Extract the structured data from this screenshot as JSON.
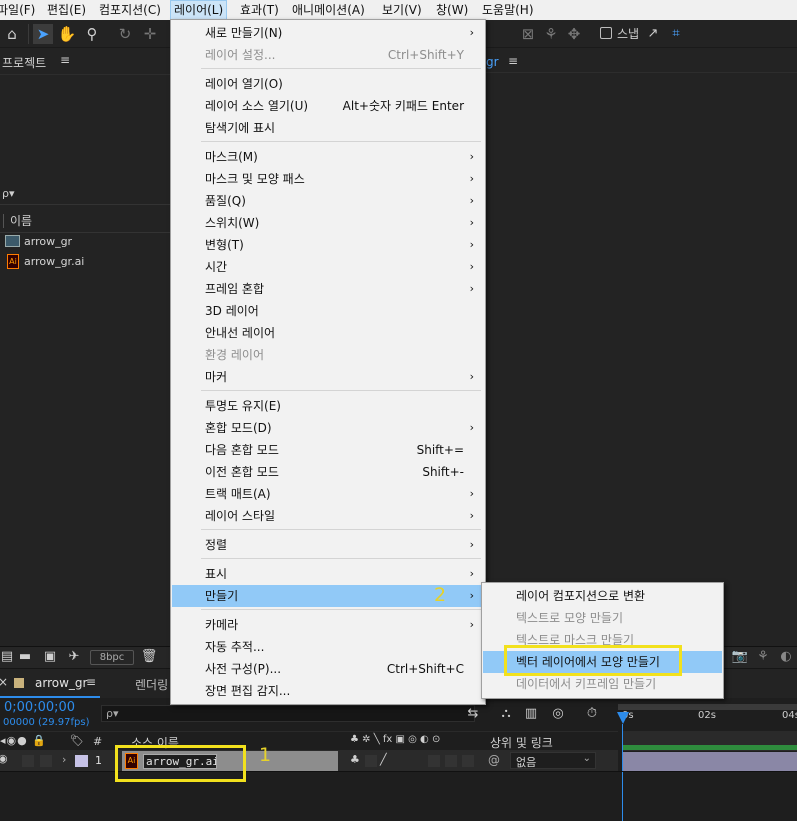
{
  "menubar": {
    "items": [
      {
        "label": "파일(F)"
      },
      {
        "label": "편집(E)"
      },
      {
        "label": "컴포지션(C)"
      },
      {
        "label": "레이어(L)"
      },
      {
        "label": "효과(T)"
      },
      {
        "label": "애니메이션(A)"
      },
      {
        "label": "보기(V)"
      },
      {
        "label": "창(W)"
      },
      {
        "label": "도움말(H)"
      }
    ]
  },
  "toolbar": {
    "snap_label": "스냅"
  },
  "project_panel": {
    "title": "프로젝트",
    "menu_glyph": "≡",
    "column_name": "이름",
    "items": [
      {
        "name": "arrow_gr",
        "icon": "composition-icon"
      },
      {
        "name": "arrow_gr.ai",
        "icon": "illustrator-file-icon"
      }
    ]
  },
  "comp_viewer": {
    "tab_fragment": "gr",
    "menu_glyph": "≡"
  },
  "bottom_strip": {
    "bpc": "8bpc"
  },
  "timeline": {
    "tab_label": "arrow_gr",
    "render_tab_label": "렌더링",
    "timecode": "0;00;00;00",
    "fps_label": "00000 (29.97fps)",
    "search_placeholder": "ρ▾",
    "col_num": "#",
    "col_source_name": "소스 이름",
    "col_parent": "상위 및 링크",
    "switches_glyphs": "♣ ✲ ╲ fx ▣ ◎ ◐ ⊙",
    "ruler": [
      "0s",
      "02s",
      "04s"
    ],
    "layer": {
      "index": "1",
      "name": "arrow_gr.ai",
      "parent_value": "없음"
    }
  },
  "layer_menu": {
    "items": [
      {
        "label": "새로 만들기(N)",
        "shortcut": "",
        "submenu": true,
        "disabled": false
      },
      {
        "label": "레이어 설정...",
        "shortcut": "Ctrl+Shift+Y",
        "submenu": false,
        "disabled": true
      },
      {
        "label": "레이어 열기(O)",
        "shortcut": "",
        "submenu": false,
        "disabled": false
      },
      {
        "label": "레이어 소스 열기(U)",
        "shortcut": "Alt+숫자 키패드 Enter",
        "submenu": false,
        "disabled": false
      },
      {
        "label": "탐색기에 표시",
        "shortcut": "",
        "submenu": false,
        "disabled": false
      },
      {
        "label": "마스크(M)",
        "shortcut": "",
        "submenu": true,
        "disabled": false
      },
      {
        "label": "마스크 및 모양 패스",
        "shortcut": "",
        "submenu": true,
        "disabled": false
      },
      {
        "label": "품질(Q)",
        "shortcut": "",
        "submenu": true,
        "disabled": false
      },
      {
        "label": "스위치(W)",
        "shortcut": "",
        "submenu": true,
        "disabled": false
      },
      {
        "label": "변형(T)",
        "shortcut": "",
        "submenu": true,
        "disabled": false
      },
      {
        "label": "시간",
        "shortcut": "",
        "submenu": true,
        "disabled": false
      },
      {
        "label": "프레임 혼합",
        "shortcut": "",
        "submenu": true,
        "disabled": false
      },
      {
        "label": "3D 레이어",
        "shortcut": "",
        "submenu": false,
        "disabled": false
      },
      {
        "label": "안내선 레이어",
        "shortcut": "",
        "submenu": false,
        "disabled": false
      },
      {
        "label": "환경 레이어",
        "shortcut": "",
        "submenu": false,
        "disabled": true
      },
      {
        "label": "마커",
        "shortcut": "",
        "submenu": true,
        "disabled": false
      },
      {
        "label": "투명도 유지(E)",
        "shortcut": "",
        "submenu": false,
        "disabled": false
      },
      {
        "label": "혼합 모드(D)",
        "shortcut": "",
        "submenu": true,
        "disabled": false
      },
      {
        "label": "다음 혼합 모드",
        "shortcut": "Shift+=",
        "submenu": false,
        "disabled": false
      },
      {
        "label": "이전 혼합 모드",
        "shortcut": "Shift+-",
        "submenu": false,
        "disabled": false
      },
      {
        "label": "트랙 매트(A)",
        "shortcut": "",
        "submenu": true,
        "disabled": false
      },
      {
        "label": "레이어 스타일",
        "shortcut": "",
        "submenu": true,
        "disabled": false
      },
      {
        "label": "정렬",
        "shortcut": "",
        "submenu": true,
        "disabled": false
      },
      {
        "label": "표시",
        "shortcut": "",
        "submenu": true,
        "disabled": false
      },
      {
        "label": "만들기",
        "shortcut": "",
        "submenu": true,
        "disabled": false,
        "highlighted": true
      },
      {
        "label": "카메라",
        "shortcut": "",
        "submenu": true,
        "disabled": false
      },
      {
        "label": "자동 추적...",
        "shortcut": "",
        "submenu": false,
        "disabled": false
      },
      {
        "label": "사전 구성(P)...",
        "shortcut": "Ctrl+Shift+C",
        "submenu": false,
        "disabled": false
      },
      {
        "label": "장면 편집 감지...",
        "shortcut": "",
        "submenu": false,
        "disabled": false
      }
    ]
  },
  "create_submenu": {
    "items": [
      {
        "label": "레이어 컴포지션으로 변환",
        "disabled": false
      },
      {
        "label": "텍스트로 모양 만들기",
        "disabled": true
      },
      {
        "label": "텍스트로 마스크 만들기",
        "disabled": true
      },
      {
        "label": "벡터 레이어에서 모양 만들기",
        "disabled": false,
        "highlighted": true
      },
      {
        "label": "데이터에서 키프레임 만들기",
        "disabled": true
      }
    ]
  },
  "annotations": {
    "step1": "1",
    "step2": "2"
  },
  "colors": {
    "highlight": "#91c9f7",
    "annotation_yellow": "#f2e11d",
    "timeline_blue": "#2d8ceb",
    "layer_bar": "#8a87a6"
  }
}
